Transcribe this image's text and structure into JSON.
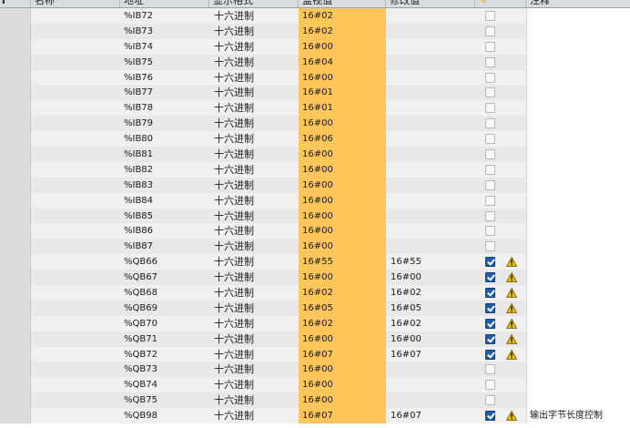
{
  "columns": {
    "c0": "i",
    "name": "名称",
    "address": "地址",
    "display_format": "显示格式",
    "monitor_value": "监视值",
    "modify_value": "修改值",
    "modify_icon": "pencil-lightning-icon",
    "comment": "注释"
  },
  "rows": [
    {
      "address": "%IB72",
      "format": "十六进制",
      "monitor": "16#02",
      "modify": "",
      "checked": false,
      "warning": false,
      "comment": ""
    },
    {
      "address": "%IB73",
      "format": "十六进制",
      "monitor": "16#02",
      "modify": "",
      "checked": false,
      "warning": false,
      "comment": ""
    },
    {
      "address": "%IB74",
      "format": "十六进制",
      "monitor": "16#00",
      "modify": "",
      "checked": false,
      "warning": false,
      "comment": ""
    },
    {
      "address": "%IB75",
      "format": "十六进制",
      "monitor": "16#04",
      "modify": "",
      "checked": false,
      "warning": false,
      "comment": ""
    },
    {
      "address": "%IB76",
      "format": "十六进制",
      "monitor": "16#00",
      "modify": "",
      "checked": false,
      "warning": false,
      "comment": ""
    },
    {
      "address": "%IB77",
      "format": "十六进制",
      "monitor": "16#01",
      "modify": "",
      "checked": false,
      "warning": false,
      "comment": ""
    },
    {
      "address": "%IB78",
      "format": "十六进制",
      "monitor": "16#01",
      "modify": "",
      "checked": false,
      "warning": false,
      "comment": ""
    },
    {
      "address": "%IB79",
      "format": "十六进制",
      "monitor": "16#00",
      "modify": "",
      "checked": false,
      "warning": false,
      "comment": ""
    },
    {
      "address": "%IB80",
      "format": "十六进制",
      "monitor": "16#06",
      "modify": "",
      "checked": false,
      "warning": false,
      "comment": ""
    },
    {
      "address": "%IB81",
      "format": "十六进制",
      "monitor": "16#00",
      "modify": "",
      "checked": false,
      "warning": false,
      "comment": ""
    },
    {
      "address": "%IB82",
      "format": "十六进制",
      "monitor": "16#00",
      "modify": "",
      "checked": false,
      "warning": false,
      "comment": ""
    },
    {
      "address": "%IB83",
      "format": "十六进制",
      "monitor": "16#00",
      "modify": "",
      "checked": false,
      "warning": false,
      "comment": ""
    },
    {
      "address": "%IB84",
      "format": "十六进制",
      "monitor": "16#00",
      "modify": "",
      "checked": false,
      "warning": false,
      "comment": ""
    },
    {
      "address": "%IB85",
      "format": "十六进制",
      "monitor": "16#00",
      "modify": "",
      "checked": false,
      "warning": false,
      "comment": ""
    },
    {
      "address": "%IB86",
      "format": "十六进制",
      "monitor": "16#00",
      "modify": "",
      "checked": false,
      "warning": false,
      "comment": ""
    },
    {
      "address": "%IB87",
      "format": "十六进制",
      "monitor": "16#00",
      "modify": "",
      "checked": false,
      "warning": false,
      "comment": ""
    },
    {
      "address": "%QB66",
      "format": "十六进制",
      "monitor": "16#55",
      "modify": "16#55",
      "checked": true,
      "warning": true,
      "comment": ""
    },
    {
      "address": "%QB67",
      "format": "十六进制",
      "monitor": "16#00",
      "modify": "16#00",
      "checked": true,
      "warning": true,
      "comment": ""
    },
    {
      "address": "%QB68",
      "format": "十六进制",
      "monitor": "16#02",
      "modify": "16#02",
      "checked": true,
      "warning": true,
      "comment": ""
    },
    {
      "address": "%QB69",
      "format": "十六进制",
      "monitor": "16#05",
      "modify": "16#05",
      "checked": true,
      "warning": true,
      "comment": ""
    },
    {
      "address": "%QB70",
      "format": "十六进制",
      "monitor": "16#02",
      "modify": "16#02",
      "checked": true,
      "warning": true,
      "comment": ""
    },
    {
      "address": "%QB71",
      "format": "十六进制",
      "monitor": "16#00",
      "modify": "16#00",
      "checked": true,
      "warning": true,
      "comment": ""
    },
    {
      "address": "%QB72",
      "format": "十六进制",
      "monitor": "16#07",
      "modify": "16#07",
      "checked": true,
      "warning": true,
      "comment": ""
    },
    {
      "address": "%QB73",
      "format": "十六进制",
      "monitor": "16#00",
      "modify": "",
      "checked": false,
      "warning": false,
      "comment": ""
    },
    {
      "address": "%QB74",
      "format": "十六进制",
      "monitor": "16#00",
      "modify": "",
      "checked": false,
      "warning": false,
      "comment": ""
    },
    {
      "address": "%QB75",
      "format": "十六进制",
      "monitor": "16#00",
      "modify": "",
      "checked": false,
      "warning": false,
      "comment": ""
    },
    {
      "address": "%QB98",
      "format": "十六进制",
      "monitor": "16#07",
      "modify": "16#07",
      "checked": true,
      "warning": true,
      "comment": "输出字节长度控制"
    }
  ],
  "colors": {
    "monitor_bg": "#ffc65c",
    "checkbox_checked": "#1f5fa8",
    "warning": "#f2c200"
  }
}
